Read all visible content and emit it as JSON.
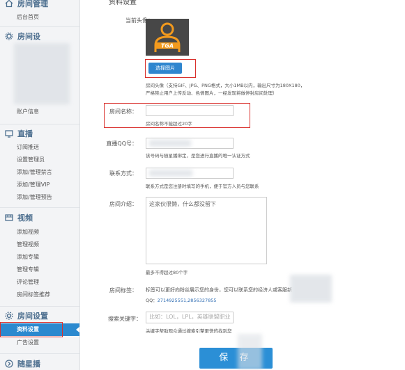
{
  "sidebar": {
    "sections": [
      {
        "label": "房间管理",
        "items": [
          "后台首页"
        ]
      },
      {
        "label": "房间设",
        "items": [
          "",
          "账户信息"
        ]
      },
      {
        "label": "直播",
        "items": [
          "订阅推送",
          "设置管理员",
          "添加/管理禁言",
          "添加/管理VIP",
          "添加/管理预告"
        ]
      },
      {
        "label": "视频",
        "items": [
          "添加视频",
          "管理视频",
          "添加专辑",
          "管理专辑",
          "评论管理",
          "房间标签推荐"
        ]
      },
      {
        "label": "房间设置",
        "items": [
          "资料设置",
          "广告设置"
        ]
      },
      {
        "label": "随星播",
        "items": []
      }
    ],
    "active_item": "资料设置",
    "accent_color": "#2b89cf"
  },
  "main": {
    "page_title": "资料设置",
    "avatar": {
      "label": "当前头像：",
      "logo_text": "TGA",
      "select_button": "选择图片",
      "hint_line1": "房间头像（支持GIF、JPG、PNG格式，大小1MB以内，输出尺寸为180X180，",
      "hint_line2": "严格禁止用户上传反动、色情图片，一经发现将做停封房间处理）"
    },
    "room_name": {
      "label": "房间名称：",
      "value": "",
      "hint": "房间名称不能超过20字"
    },
    "qq": {
      "label": "直播QQ号：",
      "value": "",
      "hint": "该号码与随星播绑定，是您进行直播的唯一认证方式"
    },
    "contact": {
      "label": "联系方式：",
      "value": "",
      "hint": "联系方式是您注册时填写的手机，便于官方人员与您联系"
    },
    "intro": {
      "label": "房间介绍：",
      "value": "这家伙很懒，什么都没留下",
      "hint": "最多不得超过80个字"
    },
    "tags": {
      "label": "房间标签：",
      "hint_line1": "标签可以更好向粉丝展示您的身份，您可以联系您的经济人或客服新",
      "hint_line2_prefix": "QQ：",
      "hint_line2_numbers": "2714925551,2856327855"
    },
    "keywords": {
      "label": "搜索关键字：",
      "placeholder": "比如：LOL，LPL，英雄联盟职业",
      "hint": "关键字帮助观众通过搜索引擎更快的找到您"
    },
    "save_button": "保 存"
  },
  "colors": {
    "primary_blue": "#2b8fd6",
    "highlight_red": "#d9302c",
    "link_blue": "#2f6db3"
  }
}
